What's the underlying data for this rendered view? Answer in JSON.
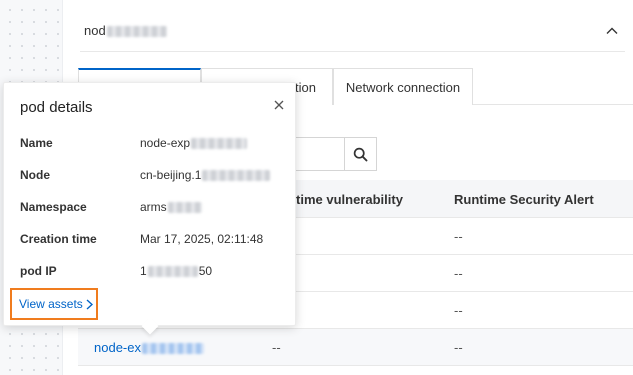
{
  "panel": {
    "title_prefix": "nod",
    "tabs": [
      {
        "label": ""
      },
      {
        "label": "ation"
      },
      {
        "label": "Network connection"
      }
    ]
  },
  "table": {
    "columns": [
      "time vulnerability",
      "Runtime Security Alert"
    ],
    "rows": [
      {
        "vuln": "",
        "alert": "--"
      },
      {
        "vuln": "",
        "alert": "--"
      },
      {
        "vuln": "",
        "alert": "--"
      },
      {
        "name_prefix": "node-ex",
        "vuln": "--",
        "alert": "--"
      }
    ]
  },
  "popover": {
    "title": "pod details",
    "fields": [
      {
        "label": "Name",
        "value": "node-exp"
      },
      {
        "label": "Node",
        "value": "cn-beijing.1"
      },
      {
        "label": "Namespace",
        "value": "arms"
      },
      {
        "label": "Creation time",
        "value": "Mar 17, 2025, 02:11:48"
      },
      {
        "label": "pod IP",
        "value": "1",
        "suffix": "50"
      }
    ],
    "link_label": "View assets"
  },
  "colors": {
    "link": "#0064c8",
    "highlight_border": "#f07c1e"
  },
  "icons": [
    "collapse-icon",
    "search-icon",
    "close-icon",
    "chevron-right-icon"
  ]
}
